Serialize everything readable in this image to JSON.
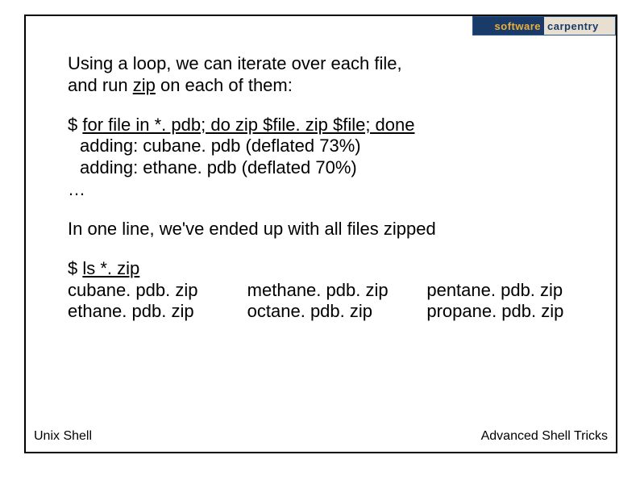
{
  "logo": {
    "left": "software",
    "right": "carpentry"
  },
  "intro": {
    "line1": "Using a loop, we can iterate over each file,",
    "line2_a": "and run ",
    "line2_u": "zip",
    "line2_b": " on each of them:"
  },
  "cmd1": {
    "prompt": "$ ",
    "command": "for file in *. pdb; do zip $file. zip $file; done",
    "out1": "adding: cubane. pdb (deflated 73%)",
    "out2": "adding: ethane. pdb (deflated 70%)",
    "out3": "…"
  },
  "mid": "In one line, we've ended up with all files zipped",
  "cmd2": {
    "prompt": "$ ",
    "command": "ls *. zip",
    "cols": [
      [
        "cubane. pdb. zip",
        "ethane. pdb. zip"
      ],
      [
        "methane. pdb. zip",
        "octane. pdb. zip"
      ],
      [
        "pentane. pdb. zip",
        "propane. pdb. zip"
      ]
    ]
  },
  "footer": {
    "left": "Unix Shell",
    "right": "Advanced Shell Tricks"
  }
}
